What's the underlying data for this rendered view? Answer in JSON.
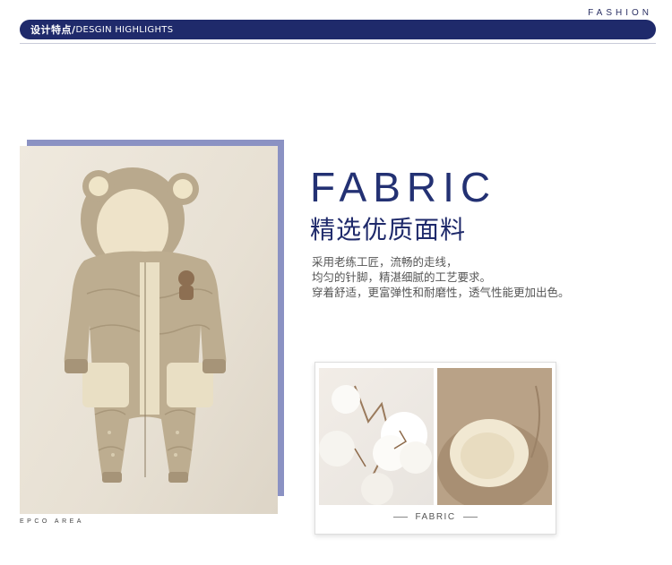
{
  "header": {
    "fashion_tag": "FASHION",
    "banner_cn": "设计特点/",
    "banner_en": "DESGIN HIGHLIGHTS"
  },
  "photo": {
    "caption": "EPCO AREA"
  },
  "section": {
    "title_en": "FABRIC",
    "title_cn": "精选优质面料",
    "body": [
      "采用老练工匠，流畅的走线，",
      "均匀的针脚，精湛细腻的工艺要求。",
      "穿着舒适，更富弹性和耐磨性，透气性能更加出色。"
    ]
  },
  "detail_card": {
    "label": "FABRIC"
  },
  "colors": {
    "brand_navy": "#1f2a6b",
    "accent_lavender": "#8b92c3"
  }
}
